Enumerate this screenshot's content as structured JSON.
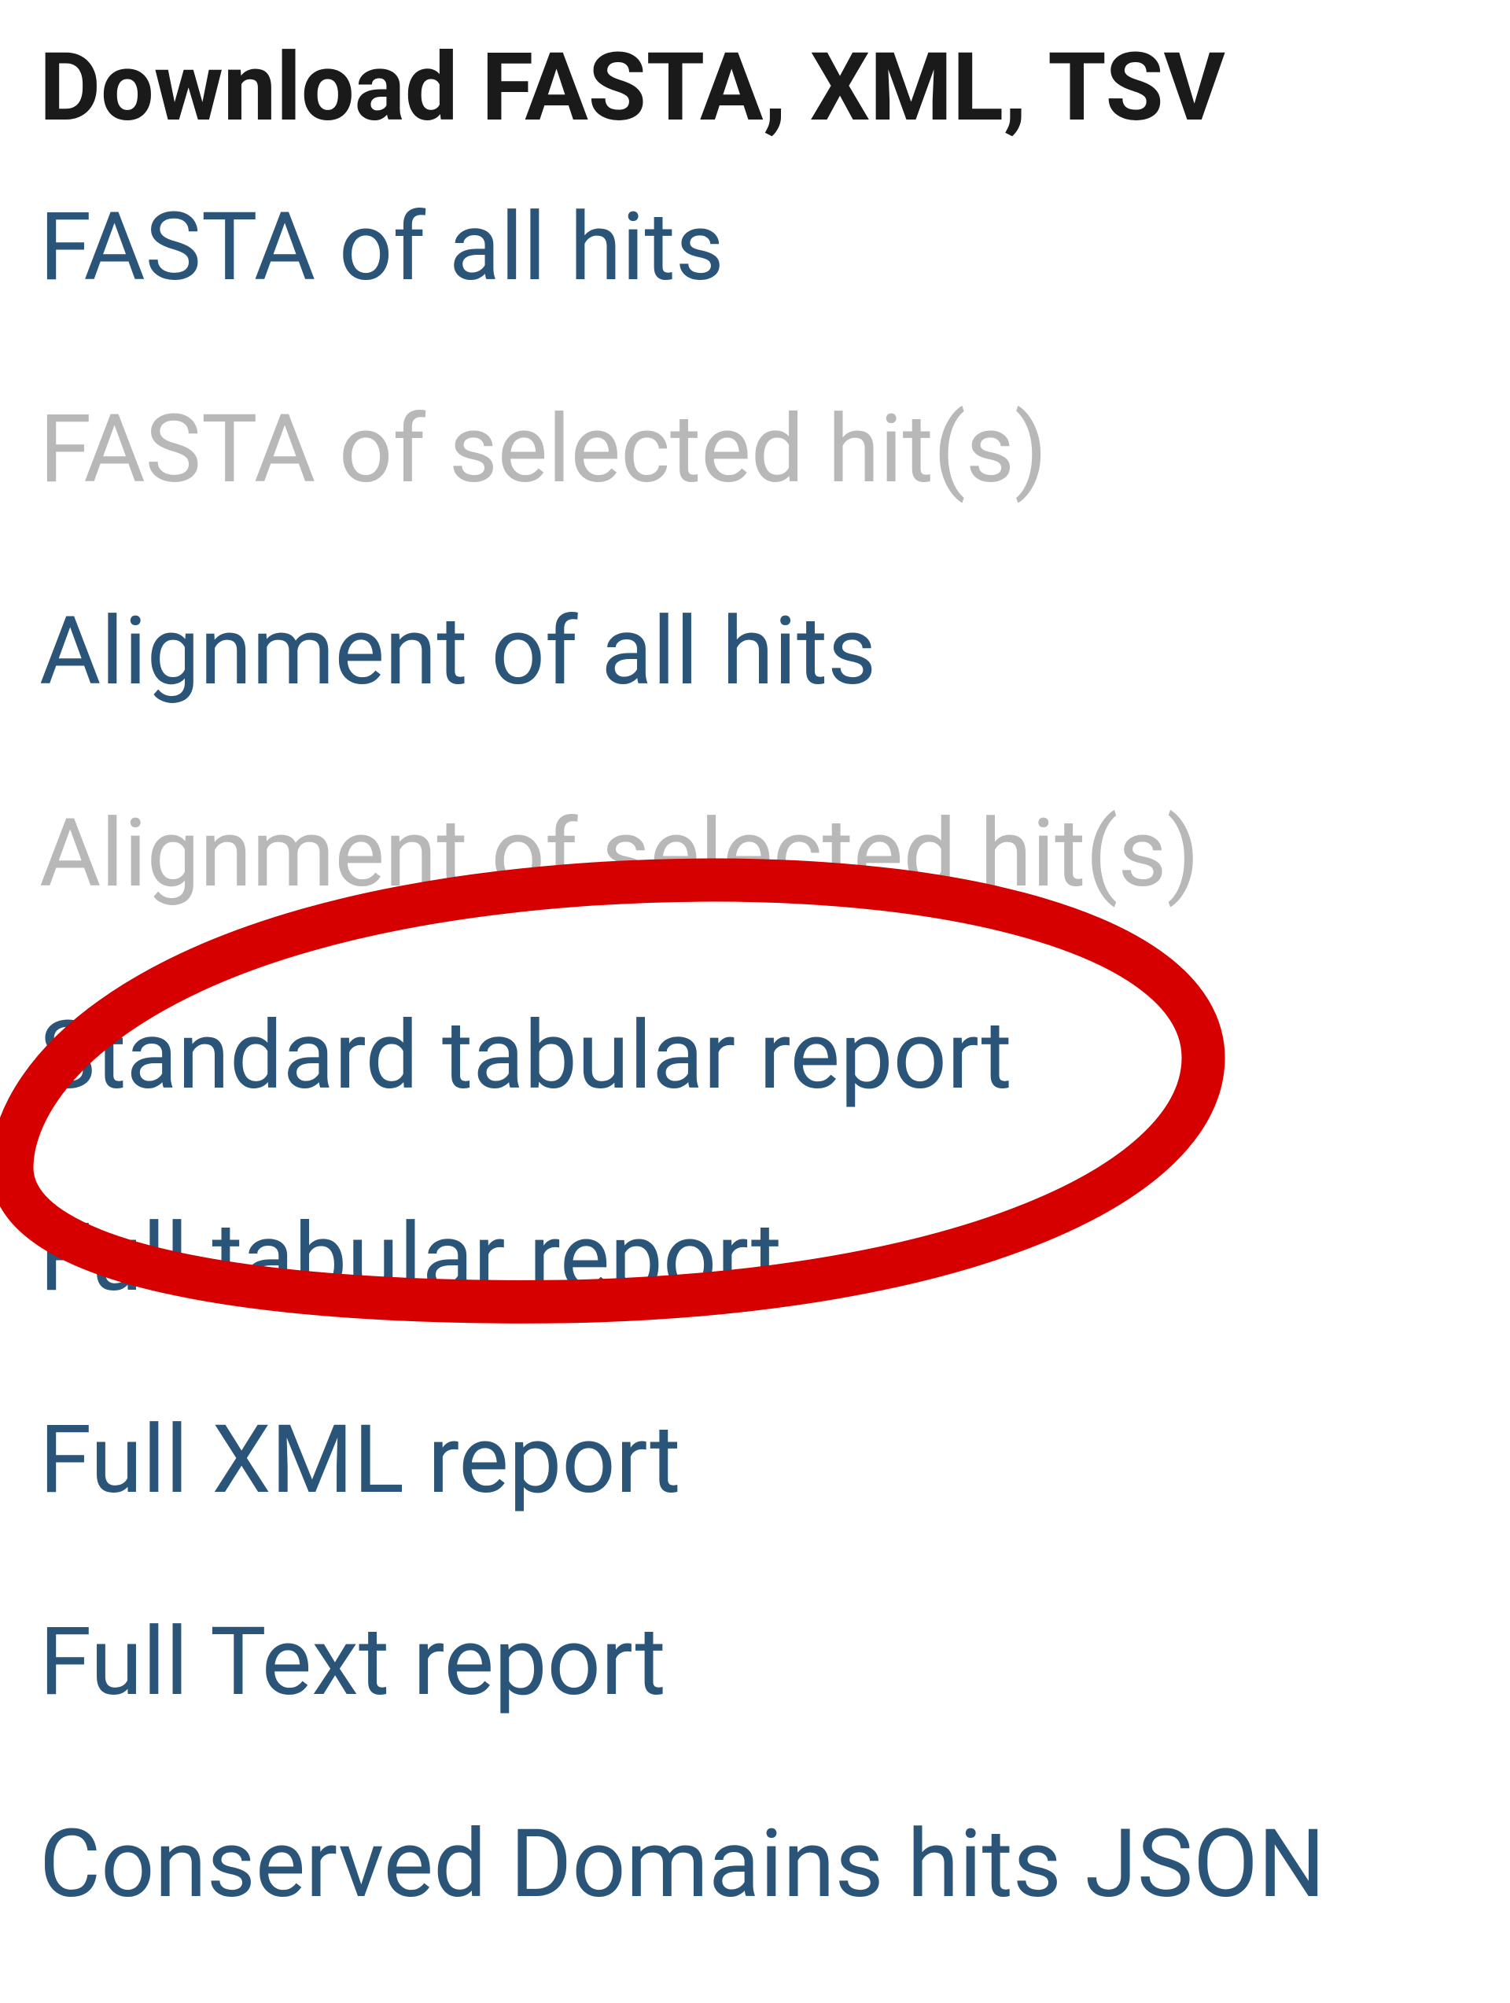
{
  "menu": {
    "header": "Download FASTA, XML, TSV",
    "items": [
      {
        "label": "FASTA of all hits",
        "enabled": true
      },
      {
        "label": "FASTA of selected hit(s)",
        "enabled": false
      },
      {
        "label": "Alignment of all hits",
        "enabled": true
      },
      {
        "label": "Alignment of selected hit(s)",
        "enabled": false
      },
      {
        "label": "Standard tabular report",
        "enabled": true
      },
      {
        "label": "Full tabular report",
        "enabled": true
      },
      {
        "label": "Full XML report",
        "enabled": true
      },
      {
        "label": "Full Text report",
        "enabled": true
      },
      {
        "label": "Conserved Domains hits JSON",
        "enabled": true
      }
    ]
  },
  "annotation": {
    "color": "#d60000",
    "targets": [
      "Standard tabular report",
      "Full tabular report"
    ]
  }
}
